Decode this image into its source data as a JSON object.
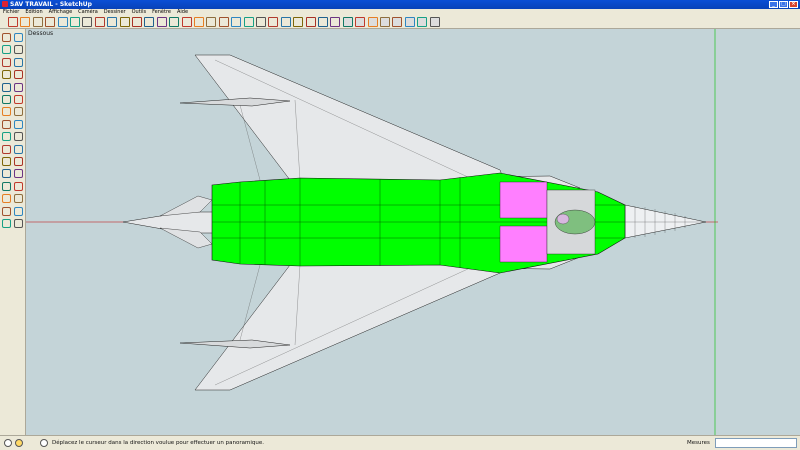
{
  "window": {
    "title": "SAV TRAVAIL - SketchUp",
    "min": "_",
    "max": "□",
    "close": "×"
  },
  "menu": [
    "Fichier",
    "Edition",
    "Affichage",
    "Caméra",
    "Dessiner",
    "Outils",
    "Fenêtre",
    "Aide"
  ],
  "toolbar": {
    "icons": [
      "select-icon",
      "eraser-icon",
      "pencil-icon",
      "rectangle-icon",
      "circle-icon",
      "arc-icon",
      "polygon-icon",
      "freehand-icon",
      "tape-icon",
      "paint-bucket-icon",
      "push-pull-icon",
      "move-icon",
      "rotate-icon",
      "offset-icon",
      "orbit-icon",
      "pan-icon",
      "zoom-icon",
      "zoom-window-icon",
      "zoom-extents-icon",
      "previous-view-icon",
      "next-view-icon",
      "measure-icon",
      "dimension-icon",
      "protractor-icon",
      "text-icon",
      "axes-icon",
      "3d-text-icon",
      "iso-view-icon",
      "top-view-icon",
      "front-view-icon",
      "right-view-icon",
      "back-view-icon",
      "left-view-icon",
      "style-xray-icon",
      "style-wireframe-icon"
    ]
  },
  "left_toolbar": {
    "icons": [
      "select-icon",
      "make-component-icon",
      "paint-bucket-icon",
      "eraser-icon",
      "rectangle-icon",
      "line-icon",
      "circle-icon",
      "arc-icon",
      "polygon-icon",
      "freehand-icon",
      "move-icon",
      "push-pull-icon",
      "rotate-icon",
      "follow-me-icon",
      "scale-icon",
      "offset-icon",
      "tape-icon",
      "dimension-icon",
      "protractor-icon",
      "text-icon",
      "axes-icon",
      "3d-text-icon",
      "orbit-icon",
      "pan-icon",
      "zoom-icon",
      "zoom-window-icon",
      "previous-icon",
      "zoom-extents-icon",
      "position-camera-icon",
      "walk-icon",
      "look-around-icon",
      "section-plane-icon"
    ]
  },
  "viewport": {
    "scene_label": "Dessous"
  },
  "status": {
    "hint": "Déplacez le curseur dans la direction voulue pour effectuer un panoramique.",
    "measures_label": "Mesures",
    "measures_value": ""
  },
  "colors": {
    "fuselage": "#00ff00",
    "canopy": "#ff7fff",
    "wing": "#e6e8ea",
    "axis_red": "#c00000",
    "axis_green": "#00c000"
  }
}
